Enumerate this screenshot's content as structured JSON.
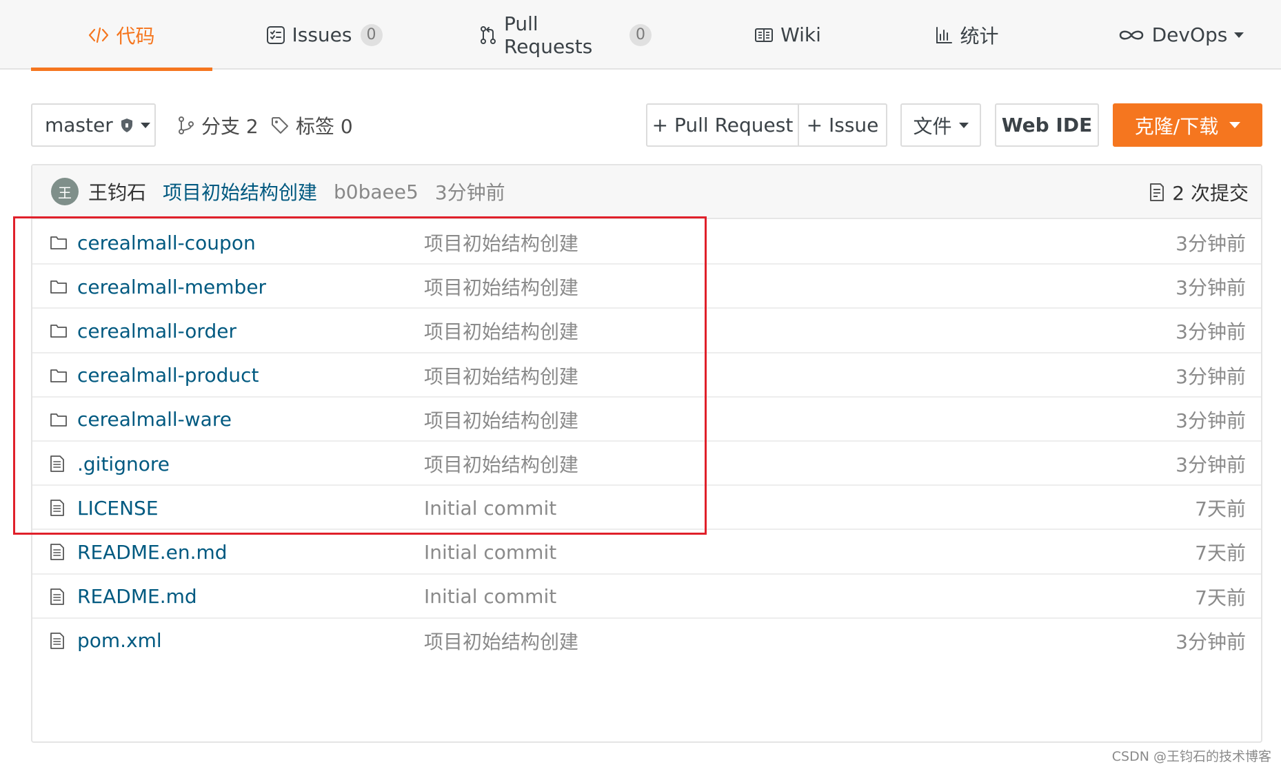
{
  "tabs": [
    {
      "label": "代码",
      "icon": "code-icon",
      "active": true
    },
    {
      "label": "Issues",
      "icon": "issues-icon",
      "badge": "0"
    },
    {
      "label": "Pull Requests",
      "icon": "pull-request-icon",
      "badge": "0"
    },
    {
      "label": "Wiki",
      "icon": "wiki-icon"
    },
    {
      "label": "统计",
      "icon": "stats-icon"
    },
    {
      "label": "DevOps",
      "icon": "infinity-icon",
      "dropdown": true
    }
  ],
  "toolbar": {
    "branch": "master",
    "branches_label": "分支 2",
    "tags_label": "标签 0",
    "pull_request_btn": "+ Pull Request",
    "issue_btn": "+ Issue",
    "file_btn": "文件",
    "web_ide_btn": "Web IDE",
    "clone_btn": "克隆/下载"
  },
  "latest_commit": {
    "avatar_char": "王",
    "author": "王钧石",
    "message": "项目初始结构创建",
    "sha": "b0baee5",
    "time": "3分钟前",
    "count_label": "2 次提交"
  },
  "files": [
    {
      "type": "folder",
      "name": "cerealmall-coupon",
      "commit": "项目初始结构创建",
      "time": "3分钟前"
    },
    {
      "type": "folder",
      "name": "cerealmall-member",
      "commit": "项目初始结构创建",
      "time": "3分钟前"
    },
    {
      "type": "folder",
      "name": "cerealmall-order",
      "commit": "项目初始结构创建",
      "time": "3分钟前"
    },
    {
      "type": "folder",
      "name": "cerealmall-product",
      "commit": "项目初始结构创建",
      "time": "3分钟前"
    },
    {
      "type": "folder",
      "name": "cerealmall-ware",
      "commit": "项目初始结构创建",
      "time": "3分钟前"
    },
    {
      "type": "file",
      "name": ".gitignore",
      "commit": "项目初始结构创建",
      "time": "3分钟前"
    },
    {
      "type": "file",
      "name": "LICENSE",
      "commit": "Initial commit",
      "time": "7天前"
    },
    {
      "type": "file",
      "name": "README.en.md",
      "commit": "Initial commit",
      "time": "7天前"
    },
    {
      "type": "file",
      "name": "README.md",
      "commit": "Initial commit",
      "time": "7天前"
    },
    {
      "type": "file",
      "name": "pom.xml",
      "commit": "项目初始结构创建",
      "time": "3分钟前"
    }
  ],
  "watermark": "CSDN @王钧石的技术博客",
  "colors": {
    "accent": "#f5761f",
    "link": "#005980",
    "highlight": "#e0202a"
  }
}
